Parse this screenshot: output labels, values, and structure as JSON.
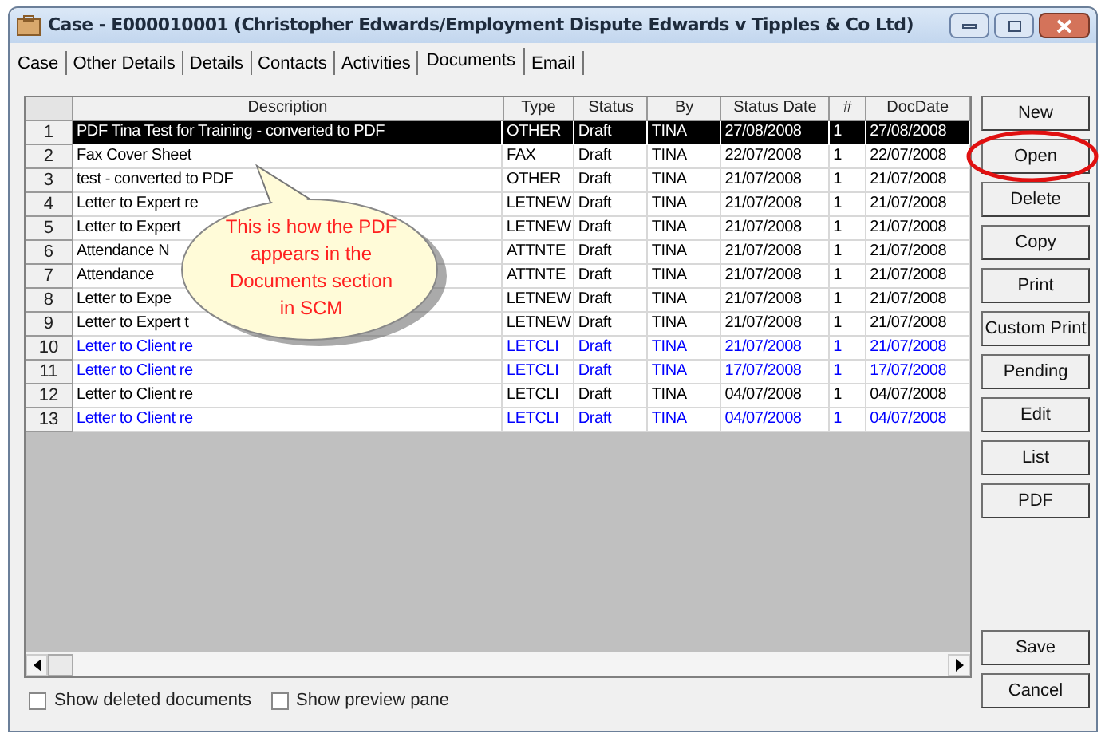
{
  "window": {
    "title": "Case - E000010001 (Christopher Edwards/Employment Dispute Edwards v Tipples & Co Ltd)"
  },
  "tabs": [
    {
      "label": "Case",
      "selected": false
    },
    {
      "label": "Other Details",
      "selected": false
    },
    {
      "label": "Details",
      "selected": false
    },
    {
      "label": "Contacts",
      "selected": false
    },
    {
      "label": "Activities",
      "selected": false
    },
    {
      "label": "Documents",
      "selected": true
    },
    {
      "label": "Email",
      "selected": false
    }
  ],
  "table": {
    "columns": [
      "Description",
      "Type",
      "Status",
      "By",
      "Status Date",
      "#",
      "DocDate"
    ],
    "rows": [
      {
        "number": "1",
        "cells": [
          "PDF Tina Test for Training - converted to PDF",
          "OTHER",
          "Draft",
          "TINA",
          "27/08/2008",
          "1",
          "27/08/2008"
        ],
        "color": "#000000",
        "selected": true
      },
      {
        "number": "2",
        "cells": [
          "Fax Cover Sheet",
          "FAX",
          "Draft",
          "TINA",
          "22/07/2008",
          "1",
          "22/07/2008"
        ],
        "color": "#000000",
        "selected": false
      },
      {
        "number": "3",
        "cells": [
          "test - converted to PDF",
          "OTHER",
          "Draft",
          "TINA",
          "21/07/2008",
          "1",
          "21/07/2008"
        ],
        "color": "#000000",
        "selected": false
      },
      {
        "number": "4",
        "cells": [
          "Letter to Expert re",
          "LETNEW",
          "Draft",
          "TINA",
          "21/07/2008",
          "1",
          "21/07/2008"
        ],
        "color": "#000000",
        "selected": false
      },
      {
        "number": "5",
        "cells": [
          "Letter to Expert",
          "LETNEW",
          "Draft",
          "TINA",
          "21/07/2008",
          "1",
          "21/07/2008"
        ],
        "color": "#000000",
        "selected": false
      },
      {
        "number": "6",
        "cells": [
          "Attendance N",
          "ATTNTE",
          "Draft",
          "TINA",
          "21/07/2008",
          "1",
          "21/07/2008"
        ],
        "color": "#000000",
        "selected": false
      },
      {
        "number": "7",
        "cells": [
          "Attendance",
          "ATTNTE",
          "Draft",
          "TINA",
          "21/07/2008",
          "1",
          "21/07/2008"
        ],
        "color": "#000000",
        "selected": false
      },
      {
        "number": "8",
        "cells": [
          "Letter to Expe",
          "LETNEW",
          "Draft",
          "TINA",
          "21/07/2008",
          "1",
          "21/07/2008"
        ],
        "color": "#000000",
        "selected": false
      },
      {
        "number": "9",
        "cells": [
          "Letter to Expert t",
          "LETNEW",
          "Draft",
          "TINA",
          "21/07/2008",
          "1",
          "21/07/2008"
        ],
        "color": "#000000",
        "selected": false
      },
      {
        "number": "10",
        "cells": [
          "Letter to Client re",
          "LETCLI",
          "Draft",
          "TINA",
          "21/07/2008",
          "1",
          "21/07/2008"
        ],
        "color": "#0000ff",
        "selected": false
      },
      {
        "number": "11",
        "cells": [
          "Letter to Client re",
          "LETCLI",
          "Draft",
          "TINA",
          "17/07/2008",
          "1",
          "17/07/2008"
        ],
        "color": "#0000ff",
        "selected": false
      },
      {
        "number": "12",
        "cells": [
          "Letter to Client re",
          "LETCLI",
          "Draft",
          "TINA",
          "04/07/2008",
          "1",
          "04/07/2008"
        ],
        "color": "#000000",
        "selected": false
      },
      {
        "number": "13",
        "cells": [
          "Letter to Client re",
          "LETCLI",
          "Draft",
          "TINA",
          "04/07/2008",
          "1",
          "04/07/2008"
        ],
        "color": "#0000ff",
        "selected": false
      }
    ]
  },
  "callout": {
    "text": "This is how the PDF appears in the Documents section in SCM"
  },
  "buttons": [
    {
      "label": "New",
      "highlighted": false
    },
    {
      "label": "Open",
      "highlighted": true
    },
    {
      "label": "Delete",
      "highlighted": false
    },
    {
      "label": "Copy",
      "highlighted": false
    },
    {
      "label": "Print",
      "highlighted": false
    },
    {
      "label": "Custom Print",
      "highlighted": false
    },
    {
      "label": "Pending",
      "highlighted": false
    },
    {
      "label": "Edit",
      "highlighted": false
    },
    {
      "label": "List",
      "highlighted": false
    },
    {
      "label": "PDF",
      "highlighted": false
    }
  ],
  "bottom_buttons": [
    "Save",
    "Cancel"
  ],
  "checkboxes": [
    {
      "label": "Show deleted documents",
      "checked": false
    },
    {
      "label": "Show preview pane",
      "checked": false
    }
  ]
}
